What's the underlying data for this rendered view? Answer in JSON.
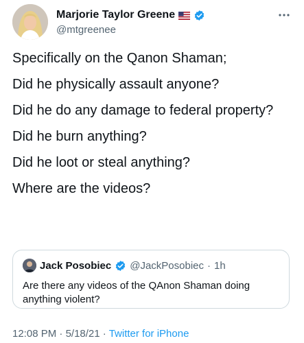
{
  "author": {
    "display_name": "Marjorie Taylor Greene",
    "handle": "@mtgreenee",
    "verified": true,
    "flag_icon": "us-flag-icon",
    "avatar_icon": "profile-photo"
  },
  "tweet": {
    "lines": [
      "Specifically on the Qanon Shaman;",
      "Did he physically assault anyone?",
      "Did he do any damage to federal property?",
      "Did he burn anything?",
      "Did he loot or steal anything?",
      "Where are the videos?"
    ]
  },
  "quoted_tweet": {
    "display_name": "Jack Posobiec",
    "handle": "@JackPosobiec",
    "separator": "·",
    "age": "1h",
    "verified": true,
    "text": "Are there any videos of the QAnon Shaman doing anything violent?"
  },
  "footer": {
    "time": "12:08 PM",
    "separator1": "·",
    "date": "5/18/21",
    "separator2": "·",
    "source": "Twitter for iPhone"
  },
  "colors": {
    "verified_blue": "#1d9bf0",
    "text": "#0f1419",
    "secondary": "#536471",
    "border": "#cfd9de"
  }
}
